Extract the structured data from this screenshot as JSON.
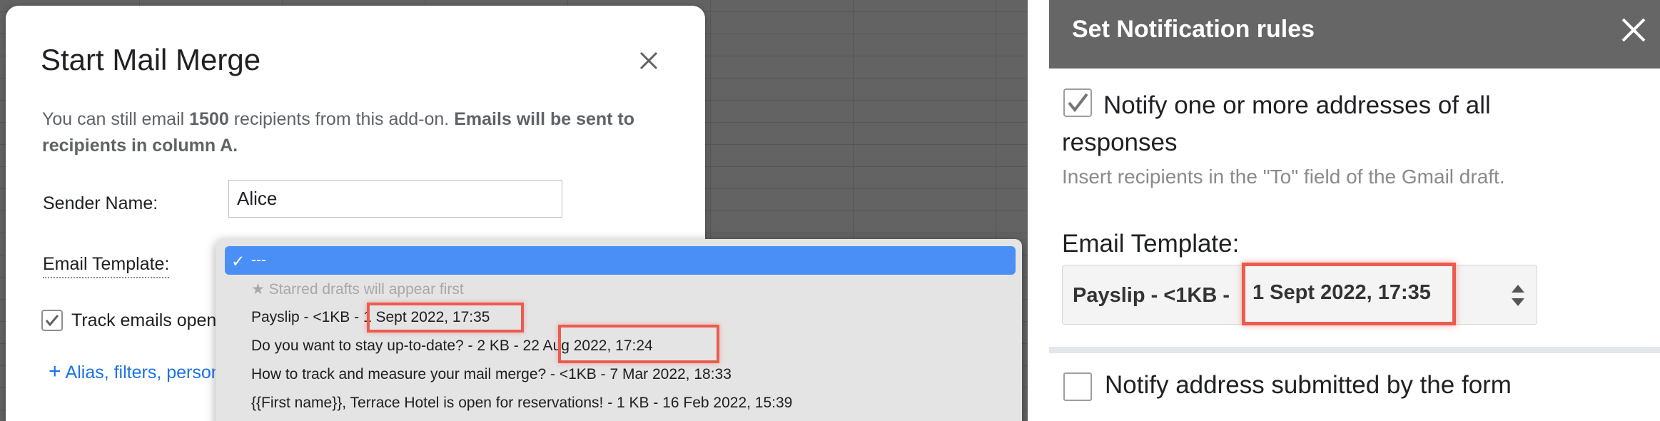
{
  "mail_merge_dialog": {
    "title": "Start Mail Merge",
    "info_prefix": "You can still email ",
    "info_count": "1500",
    "info_middle": " recipients from this add-on. ",
    "info_bold": "Emails will be sent to recipients in column A.",
    "sender_label": "Sender Name:",
    "sender_value": "Alice",
    "template_label": "Email Template:",
    "track_label": "Track emails opened",
    "alias_link": "Alias, filters, personalize",
    "close_icon": "close-icon"
  },
  "template_dropdown": {
    "options": [
      {
        "label": "---",
        "selected": true
      },
      {
        "label": "★ Starred drafts will appear first",
        "disabled": true
      },
      {
        "label": "Payslip - <1KB - 1 Sept 2022, 17:35"
      },
      {
        "label": "Do you want to stay up-to-date? - 2 KB - 22 Aug 2022, 17:24"
      },
      {
        "label": "How to track and measure your mail merge? - <1KB - 7 Mar 2022, 18:33"
      },
      {
        "label": "{{First name}}, Terrace Hotel is open for reservations! - 1 KB - 16 Feb 2022, 15:39"
      }
    ],
    "highlight_color": "#ec5b4f"
  },
  "notification_panel": {
    "title": "Set Notification rules",
    "option1_label": "Notify one or more addresses of all responses",
    "option1_checked": true,
    "option1_help": "Insert recipients in the \"To\" field of the Gmail draft.",
    "template_label": "Email Template:",
    "template_prefix": "Payslip - <1KB -",
    "template_date": "1 Sept 2022, 17:35",
    "option2_label": "Notify address submitted by the form",
    "option2_checked": false,
    "header_color": "#666666"
  }
}
